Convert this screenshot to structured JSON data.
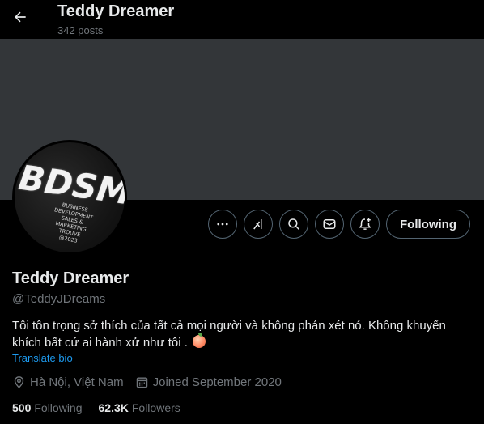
{
  "header": {
    "title": "Teddy Dreamer",
    "post_count": "342 posts",
    "back_icon": "arrow-left-icon"
  },
  "avatar": {
    "big_text": "BDSM",
    "small_text": "BUSINESS\nDEVELOPMENT\nSALES &\nMARKETING\nTROUVE\n@2023"
  },
  "actions": {
    "more_icon": "more-horizontal-icon",
    "grok_icon": "grok-icon",
    "search_icon": "search-icon",
    "message_icon": "envelope-icon",
    "notify_icon": "bell-plus-icon",
    "following_label": "Following"
  },
  "profile": {
    "display_name": "Teddy Dreamer",
    "handle": "@TeddyJDreams",
    "bio": "Tôi tôn trọng sở thích của tất cả mọi người và không phán xét nó. Không khuyến khích bất cứ ai hành xử như tôi .",
    "bio_emoji": "peach-emoji",
    "translate_label": "Translate bio",
    "location": "Hà Nội, Việt Nam",
    "joined": "Joined September 2020"
  },
  "stats": {
    "following_count": "500",
    "following_label": "Following",
    "followers_count": "62.3K",
    "followers_label": "Followers"
  },
  "colors": {
    "background": "#000000",
    "banner": "#333639",
    "text": "#e7e9ea",
    "secondary": "#71767b",
    "link": "#1d9bf0",
    "border": "#536471"
  }
}
